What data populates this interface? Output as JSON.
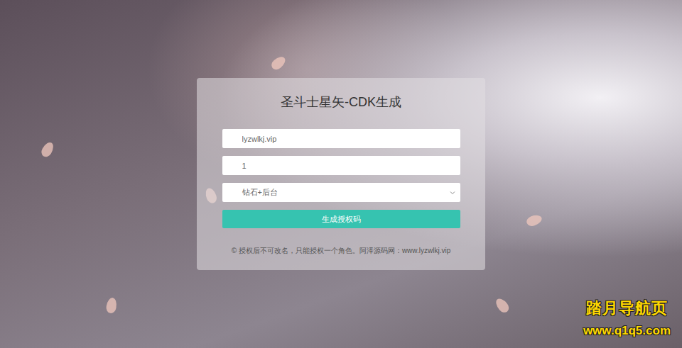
{
  "title": "圣斗士星矢-CDK生成",
  "fields": [
    {
      "value": "lyzwlkj.vip"
    },
    {
      "value": "1"
    }
  ],
  "select": {
    "value": "钻石+后台"
  },
  "button": "生成授权码",
  "footer": "© 授权后不可改名，只能授权一个角色。阿泽源码网：www.lyzwlkj.vip",
  "watermark": {
    "title": "踏月导航页",
    "url": "www.q1q5.com"
  }
}
